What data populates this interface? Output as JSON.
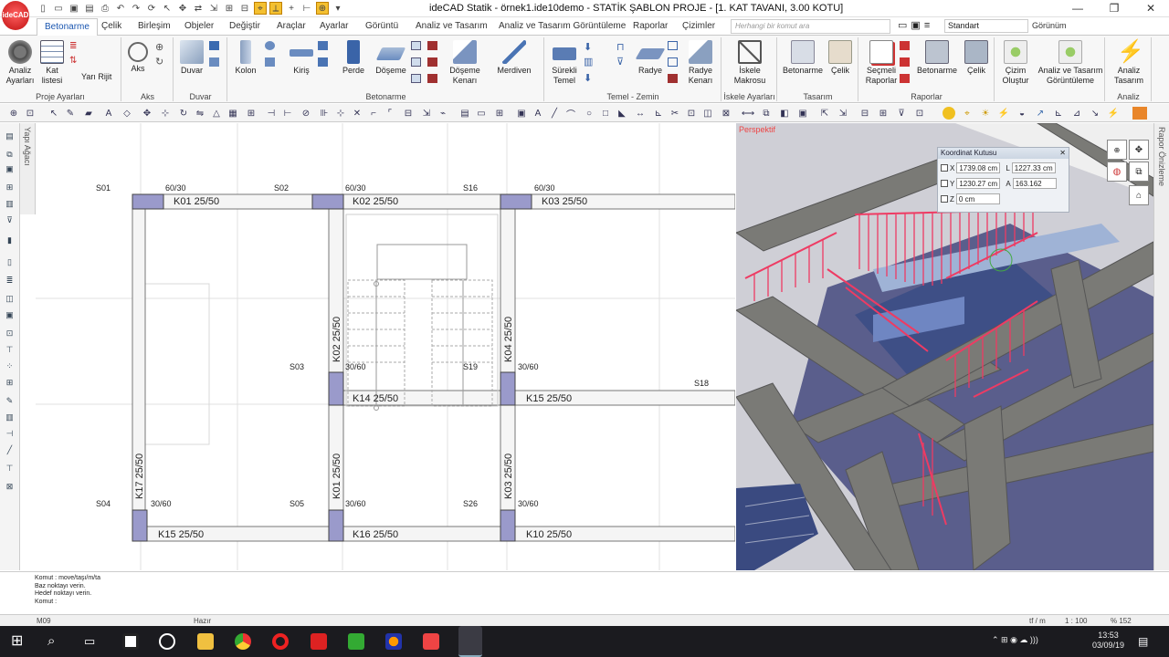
{
  "app": {
    "logo": "ideCAD",
    "title": "ideCAD Statik - örnek1.ide10demo - STATİK ŞABLON PROJE - [1. KAT TAVANI,  3.00 KOTU]"
  },
  "window_controls": {
    "minimize": "—",
    "restore": "❐",
    "close": "✕"
  },
  "tabs": [
    "Betonarme",
    "Çelik",
    "Birleşim",
    "Objeler",
    "Değiştir",
    "Araçlar",
    "Ayarlar",
    "Görüntü",
    "Analiz ve Tasarım",
    "Analiz ve Tasarım Görüntüleme",
    "Raporlar",
    "Çizimler"
  ],
  "search": {
    "placeholder": "Herhangi bir komut ara"
  },
  "style_combo": "Standart",
  "gorunum_label": "Görünüm",
  "ribbon": {
    "groups": {
      "proje": "Proje Ayarları",
      "aks": "Aks",
      "duvar": "Duvar",
      "betonarme": "Betonarme",
      "temel": "Temel - Zemin",
      "iskele": "İskele Ayarları",
      "tasarim": "Tasarım",
      "raporlar": "Raporlar",
      "analiz": "Analiz"
    },
    "buttons": {
      "analiz_ayarlari": "Analiz\nAyarları",
      "kat_listesi": "Kat\nlistesi",
      "yari_rijit": "Yarı Rijit",
      "aks": "Aks",
      "duvar": "Duvar",
      "kolon": "Kolon",
      "kiris": "Kiriş",
      "perde": "Perde",
      "doseme": "Döşeme",
      "doseme_kenari": "Döşeme\nKenarı",
      "merdiven": "Merdiven",
      "surekli_temel": "Sürekli\nTemel",
      "radye": "Radye",
      "radye_kenari": "Radye\nKenarı",
      "iskele_makrosu": "İskele\nMakrosu",
      "betonarme_tas": "Betonarme",
      "celik_tas": "Çelik",
      "secmeli_raporlar": "Seçmeli\nRaporlar",
      "betonarme_rap": "Betonarme",
      "celik_rap": "Çelik",
      "cizim_olustur": "Çizim\nOluştur",
      "analiz_tasarim_gor": "Analiz ve Tasarım\nGörüntüleme",
      "analiz_tasarim": "Analiz\nTasarım"
    }
  },
  "left_panel": {
    "label": "Yapı Ağacı"
  },
  "right_panel": {
    "label": "Rapor Önizleme"
  },
  "plan": {
    "axis_labels": [
      "S01",
      "S02",
      "S16",
      "S03",
      "S19",
      "S18",
      "S04",
      "S05",
      "S26"
    ],
    "col_dims": [
      "60/30",
      "60/30",
      "60/30",
      "30/60",
      "30/60",
      "30/60",
      "30/60",
      "30/60"
    ],
    "beams_h": [
      "K01 25/50",
      "K02 25/50",
      "K03 25/50",
      "K14 25/50",
      "K15 25/50",
      "K15 25/50",
      "K16 25/50",
      "K10 25/50"
    ],
    "beams_v": [
      "K02 25/50",
      "K04 25/50",
      "K17 25/50",
      "K01 25/50",
      "K03 25/50"
    ]
  },
  "view3d": {
    "label": "Perspektif",
    "coord_box": {
      "title": "Koordinat Kutusu",
      "x_label": "X",
      "x_value": "1739.08 cm",
      "y_label": "Y",
      "y_value": "1230.27 cm",
      "z_label": "Z",
      "z_value": "0 cm",
      "l_label": "L",
      "l_value": "1227.33 cm",
      "a_label": "A",
      "a_value": "163.162"
    }
  },
  "command": {
    "lines": [
      "Komut : move/taşı/m/ta",
      "Baz noktayı verin.",
      "Hedef noktayı verin.",
      "Komut :"
    ]
  },
  "status": {
    "layer": "M09",
    "state": "Hazır",
    "units": "tf / m",
    "scale": "1 : 100",
    "zoom": "% 152"
  },
  "taskbar": {
    "time": "13:53",
    "date": "03/09/19",
    "tray_icons": "⌃  ⊞  ◉  ☁  ))) "
  }
}
